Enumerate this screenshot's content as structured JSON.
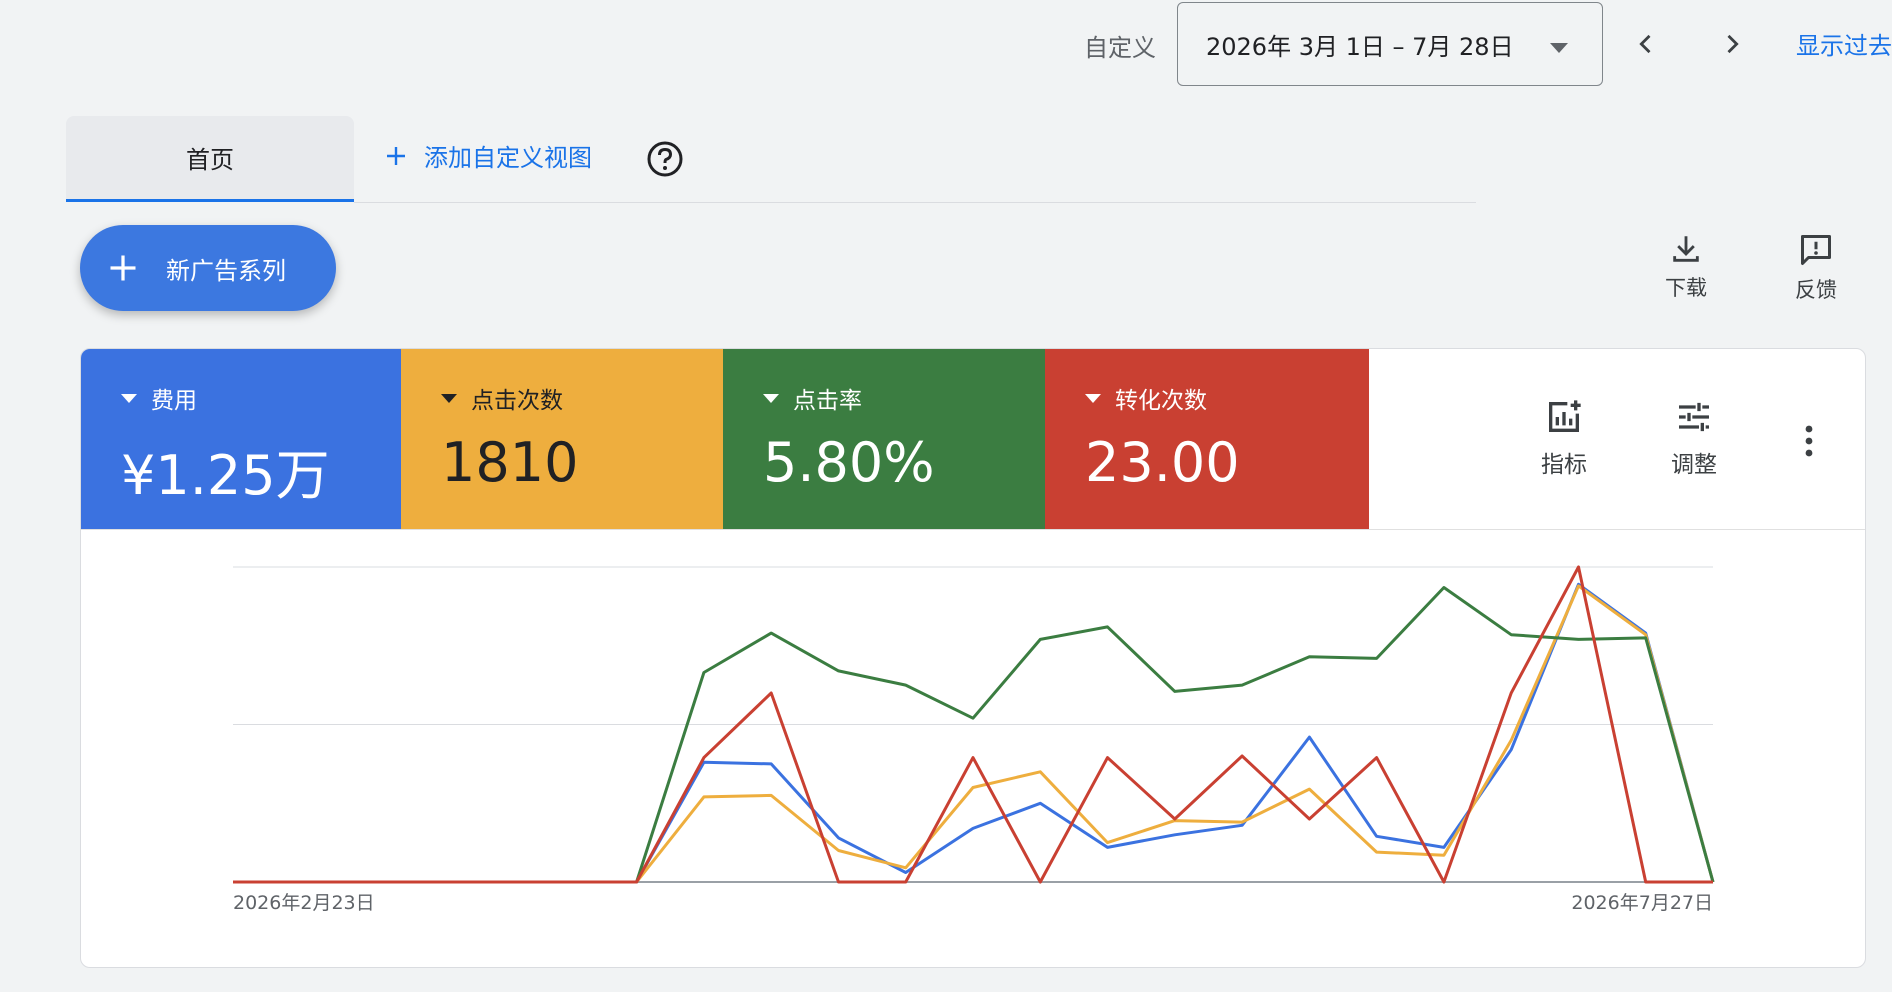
{
  "header": {
    "date_range_label": "自定义",
    "date_range_value": "2026年 3月 1日 – 7月 28日",
    "show_past": "显示过去"
  },
  "tabs": {
    "home": "首页",
    "add_custom_view": "添加自定义视图"
  },
  "new_campaign_label": "新广告系列",
  "toolbar": {
    "download": "下载",
    "feedback": "反馈"
  },
  "metrics": [
    {
      "label": "费用",
      "value": "¥1.25万",
      "color": "#3b72e0"
    },
    {
      "label": "点击次数",
      "value": "1810",
      "color": "#eeae3e"
    },
    {
      "label": "点击率",
      "value": "5.80%",
      "color": "#3b7d41"
    },
    {
      "label": "转化次数",
      "value": "23.00",
      "color": "#c94032"
    }
  ],
  "card_tools": {
    "metrics": "指标",
    "adjust": "调整"
  },
  "chart_data": {
    "type": "line",
    "x_start_label": "2026年2月23日",
    "x_end_label": "2026年7月27日",
    "grid": true,
    "y_scale": "normalized",
    "ylim": [
      0,
      1
    ],
    "series": [
      {
        "color": "#3b72e0",
        "values": [
          0,
          0,
          0,
          0,
          0,
          0,
          0,
          0.38,
          0.375,
          0.14,
          0.03,
          0.17,
          0.25,
          0.11,
          0.15,
          0.18,
          0.46,
          0.145,
          0.11,
          0.42,
          0.945,
          0.79,
          0
        ]
      },
      {
        "color": "#eeae3e",
        "values": [
          0,
          0,
          0,
          0,
          0,
          0,
          0,
          0.27,
          0.275,
          0.1,
          0.045,
          0.3,
          0.35,
          0.125,
          0.195,
          0.19,
          0.295,
          0.095,
          0.085,
          0.45,
          0.94,
          0.785,
          0
        ]
      },
      {
        "color": "#3b7d41",
        "values": [
          0,
          0,
          0,
          0,
          0,
          0,
          0,
          0.665,
          0.79,
          0.67,
          0.625,
          0.52,
          0.77,
          0.81,
          0.605,
          0.625,
          0.715,
          0.71,
          0.935,
          0.785,
          0.77,
          0.775,
          0
        ]
      },
      {
        "color": "#c94032",
        "values": [
          0,
          0,
          0,
          0,
          0,
          0,
          0,
          0.395,
          0.6,
          0,
          0,
          0.395,
          0,
          0.395,
          0.2,
          0.4,
          0.2,
          0.395,
          0,
          0.6,
          1.0,
          0,
          0
        ]
      }
    ]
  }
}
